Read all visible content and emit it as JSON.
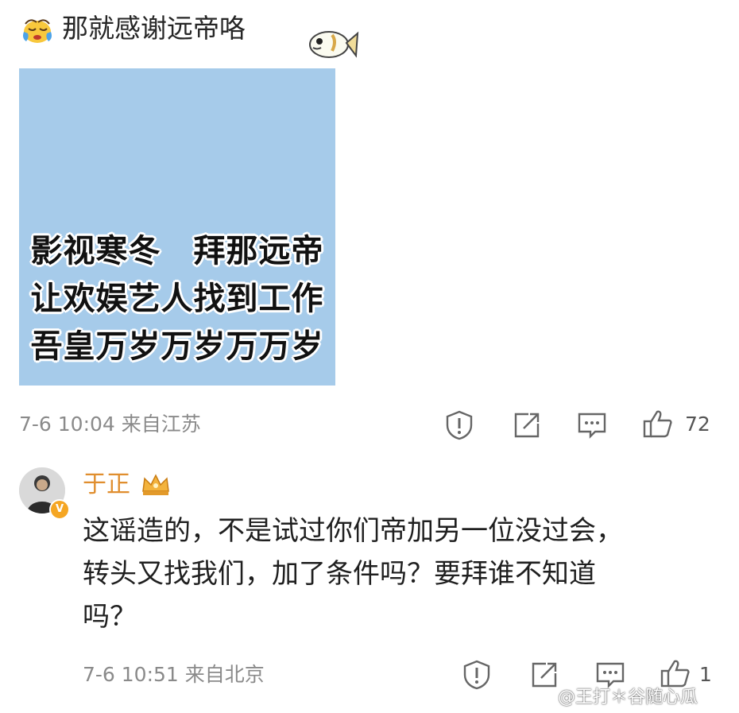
{
  "top_comment": {
    "text": "那就感谢远帝咯",
    "image_card": {
      "lines": [
        "影视寒冬　拜那远帝",
        "让欢娱艺人找到工作",
        "吾皇万岁万岁万万岁"
      ],
      "background": "#a6cbea"
    },
    "timestamp": "7-6 10:04",
    "location": "来自江苏",
    "like_count": "72"
  },
  "reply": {
    "username": "于正",
    "username_color": "#e08e2e",
    "text_lines": [
      "这谣造的，不是试过你们帝加另一位没过会，",
      "转头又找我们，加了条件吗？要拜谁不知道",
      "吗？"
    ],
    "timestamp": "7-6 10:51",
    "location": "来自北京",
    "like_count": "1"
  },
  "watermark": "@王打＊谷随心瓜",
  "icons": [
    "report-icon",
    "share-icon",
    "comment-icon",
    "like-icon"
  ]
}
